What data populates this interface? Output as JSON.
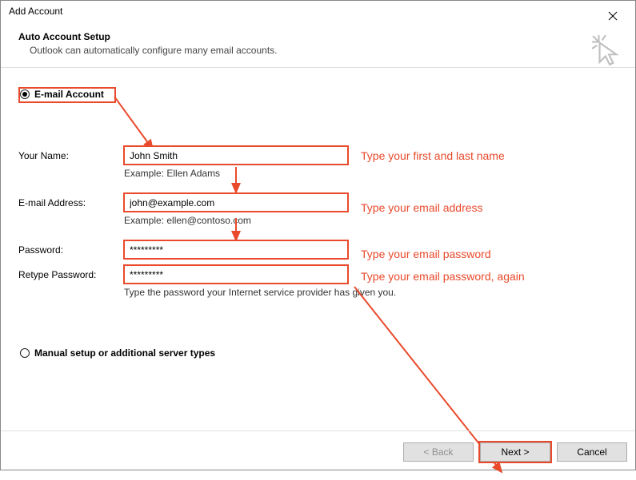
{
  "window": {
    "title": "Add Account"
  },
  "header": {
    "title": "Auto Account Setup",
    "subtitle": "Outlook can automatically configure many email accounts."
  },
  "radios": {
    "email_account_label": "E-mail Account",
    "manual_setup_label": "Manual setup or additional server types"
  },
  "form": {
    "your_name": {
      "label": "Your Name:",
      "value": "John Smith",
      "example": "Example: Ellen Adams"
    },
    "email": {
      "label": "E-mail Address:",
      "value": "john@example.com",
      "example": "Example: ellen@contoso.com"
    },
    "password": {
      "label": "Password:",
      "value": "*********"
    },
    "retype": {
      "label": "Retype Password:",
      "value": "*********"
    },
    "password_note": "Type the password your Internet service provider has given you."
  },
  "annotations": {
    "name": "Type your first and last name",
    "email": "Type your email address",
    "pw": "Type your email password",
    "pw2": "Type your email password, again"
  },
  "footer": {
    "back": "< Back",
    "next": "Next >",
    "cancel": "Cancel"
  }
}
